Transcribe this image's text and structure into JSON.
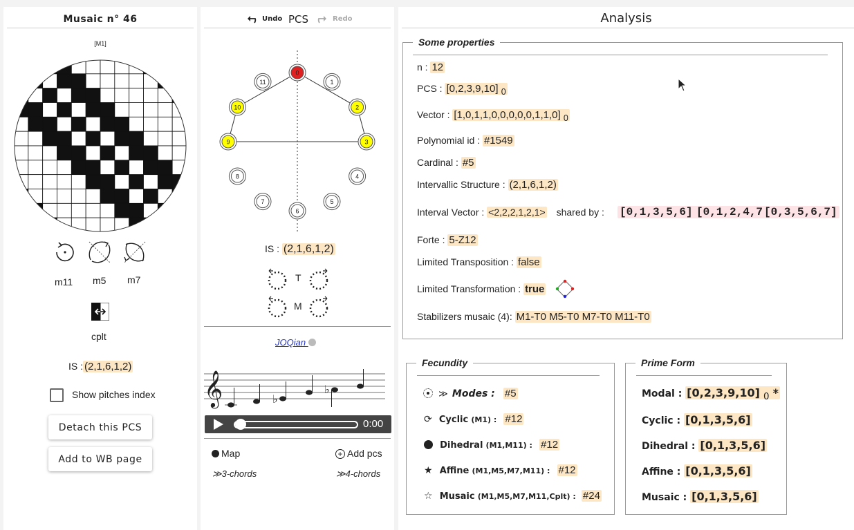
{
  "left": {
    "title": "Musaic n° 46",
    "tag": "[M1]",
    "transform_labels": [
      "m11",
      "m5",
      "m7"
    ],
    "cplt_label": "cplt",
    "is_label": "IS :",
    "is_value": "(2,1,6,1,2)",
    "show_pitches_label": "Show pitches index",
    "detach_button": "Detach this PCS",
    "add_wb_button": "Add to WB page"
  },
  "middle": {
    "undo_label": "Undo",
    "title": "PCS",
    "redo_label": "Redo",
    "clock_nodes": [
      "0",
      "1",
      "2",
      "3",
      "4",
      "5",
      "6",
      "7",
      "8",
      "9",
      "10",
      "11"
    ],
    "selected_pitches": [
      0,
      2,
      3,
      9,
      10
    ],
    "is_label": "IS :",
    "is_value": "(2,1,6,1,2)",
    "t_label": "T",
    "m_label": "M",
    "link_text": "JOQian",
    "time": "0:00",
    "map_label": "Map",
    "add_pcs_label": "Add pcs",
    "chords3_label": "3-chords",
    "chords4_label": "4-chords"
  },
  "analysis": {
    "title": "Analysis",
    "props_legend": "Some properties",
    "n_label": "n : ",
    "n_value": "12",
    "pcs_label": "PCS : ",
    "pcs_value": "[0,2,3,9,10]",
    "pcs_sub": "0",
    "vector_label": "Vector : ",
    "vector_value": "[1,0,1,1,0,0,0,0,0,1,1,0]",
    "vector_sub": "0",
    "poly_label": "Polynomial id : ",
    "poly_value": "#1549",
    "card_label": "Cardinal : ",
    "card_value": "#5",
    "is_label": "Intervallic Structure : ",
    "is_value": "(2,1,6,1,2)",
    "iv_label": "Interval Vector : ",
    "iv_value": "<2,2,2,1,2,1>",
    "shared_label": "shared by :",
    "shared_items": [
      "[0,1,3,5,6] *",
      "[0,1,2,4,7]",
      "[0,3,5,6,7]"
    ],
    "forte_label": "Forte : ",
    "forte_value": "5-Z12",
    "lt_label": "Limited Transposition : ",
    "lt_value": "false",
    "ltf_label": "Limited Transformation : ",
    "ltf_value": "true",
    "stab_label": "Stabilizers musaic (4): ",
    "stab_value": "M1-T0 M5-T0 M7-T0 M11-T0"
  },
  "fecundity": {
    "legend": "Fecundity",
    "modes_label": "Modes :",
    "modes_value": "#5",
    "cyclic_label": "Cyclic",
    "cyclic_group": "(M1) :",
    "cyclic_value": "#12",
    "dihedral_label": "Dihedral",
    "dihedral_group": "(M1,M11) :",
    "dihedral_value": "#12",
    "affine_label": "Affine",
    "affine_group": "(M1,M5,M7,M11) :",
    "affine_value": "#12",
    "musaic_label": "Musaic",
    "musaic_group": "(M1,M5,M7,M11,Cplt) :",
    "musaic_value": "#24"
  },
  "prime_form": {
    "legend": "Prime Form",
    "modal_label": "Modal : ",
    "modal_value": "[0,2,3,9,10]",
    "modal_sub": "0",
    "modal_star": "*",
    "cyclic_label": "Cyclic : ",
    "cyclic_value": "[0,1,3,5,6]",
    "dihedral_label": "Dihedral : ",
    "dihedral_value": "[0,1,3,5,6]",
    "affine_label": "Affine : ",
    "affine_value": "[0,1,3,5,6]",
    "musaic_label": "Musaic : ",
    "musaic_value": "[0,1,3,5,6]"
  },
  "colors": {
    "highlight": "#fde6c4",
    "selected_node": "#ffff00",
    "root_node": "#e02020",
    "pink": "#fde3e6"
  }
}
